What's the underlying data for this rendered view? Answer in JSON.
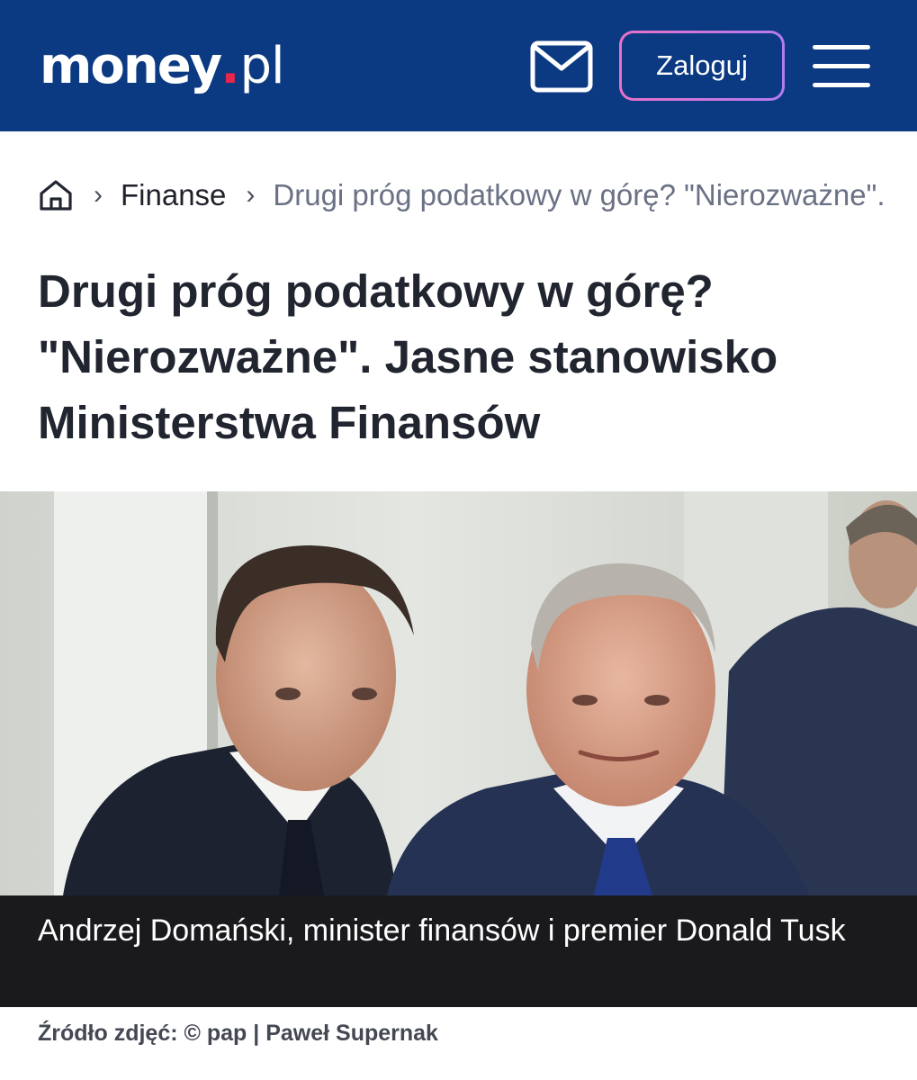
{
  "header": {
    "logo": {
      "name": "money",
      "dot": ".",
      "tld": "pl"
    },
    "mail_icon": "mail-envelope-icon",
    "login_label": "Zaloguj",
    "menu_icon": "hamburger-menu-icon",
    "colors": {
      "background": "#0b3a82",
      "logo_dot": "#e8264b",
      "login_border_from": "#e872c8",
      "login_border_to": "#b27bf0"
    }
  },
  "breadcrumb": {
    "home_icon": "home-icon",
    "items": [
      "Finanse",
      "Drugi próg podatkowy w górę? \"Nierozważne\". Jasne stanowisko Ministerstwa Finansów"
    ]
  },
  "article": {
    "title": "Drugi próg podatkowy w górę? \"Nierozważne\". Jasne stanowisko Ministerstwa Finansów",
    "image": {
      "caption": "Andrzej Domański, minister finansów i premier Donald Tusk",
      "source": "Źródło zdjęć: © pap | Paweł Supernak"
    }
  }
}
